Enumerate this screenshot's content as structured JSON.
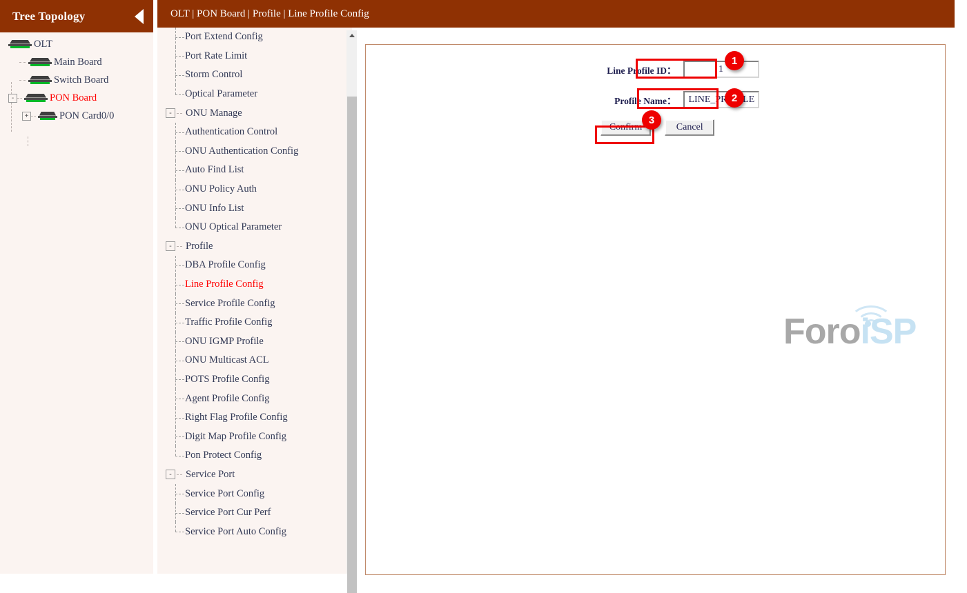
{
  "sidebar": {
    "title": "Tree Topology",
    "collapse_icon": "triangle-left-icon",
    "tree": [
      {
        "label": "OLT",
        "level": 0,
        "icon": "device-olt-icon",
        "expander": null,
        "highlight": false
      },
      {
        "label": "Main Board",
        "level": 1,
        "icon": "device-board-icon",
        "expander": null,
        "highlight": false
      },
      {
        "label": "Switch Board",
        "level": 1,
        "icon": "device-board-icon",
        "expander": null,
        "highlight": false
      },
      {
        "label": "PON Board",
        "level": 1,
        "icon": "device-board-icon",
        "expander": "-",
        "highlight": true
      },
      {
        "label": "PON Card0/0",
        "level": 2,
        "icon": "device-board-icon",
        "expander": "+",
        "highlight": false
      }
    ]
  },
  "topbar": {
    "breadcrumb": "OLT | PON Board | Profile | Line Profile Config"
  },
  "menu": {
    "items": [
      {
        "label": "Port Extend Config",
        "type": "leaf",
        "active": false
      },
      {
        "label": "Port Rate Limit",
        "type": "leaf",
        "active": false
      },
      {
        "label": "Storm Control",
        "type": "leaf",
        "active": false
      },
      {
        "label": "Optical Parameter",
        "type": "leaf",
        "active": false,
        "last": true
      },
      {
        "label": "ONU Manage",
        "type": "group",
        "active": false,
        "expander": "-"
      },
      {
        "label": "Authentication Control",
        "type": "leaf",
        "active": false
      },
      {
        "label": "ONU Authentication Config",
        "type": "leaf",
        "active": false
      },
      {
        "label": "Auto Find List",
        "type": "leaf",
        "active": false
      },
      {
        "label": "ONU Policy Auth",
        "type": "leaf",
        "active": false
      },
      {
        "label": "ONU Info List",
        "type": "leaf",
        "active": false
      },
      {
        "label": "ONU Optical Parameter",
        "type": "leaf",
        "active": false,
        "last": true
      },
      {
        "label": "Profile",
        "type": "group",
        "active": false,
        "expander": "-"
      },
      {
        "label": "DBA Profile Config",
        "type": "leaf",
        "active": false
      },
      {
        "label": "Line Profile Config",
        "type": "leaf",
        "active": true
      },
      {
        "label": "Service Profile Config",
        "type": "leaf",
        "active": false
      },
      {
        "label": "Traffic Profile Config",
        "type": "leaf",
        "active": false
      },
      {
        "label": "ONU IGMP Profile",
        "type": "leaf",
        "active": false
      },
      {
        "label": "ONU Multicast ACL",
        "type": "leaf",
        "active": false
      },
      {
        "label": "POTS Profile Config",
        "type": "leaf",
        "active": false
      },
      {
        "label": "Agent Profile Config",
        "type": "leaf",
        "active": false
      },
      {
        "label": "Right Flag Profile Config",
        "type": "leaf",
        "active": false
      },
      {
        "label": "Digit Map Profile Config",
        "type": "leaf",
        "active": false
      },
      {
        "label": "Pon Protect Config",
        "type": "leaf",
        "active": false,
        "last": true
      },
      {
        "label": "Service Port",
        "type": "group",
        "active": false,
        "expander": "-"
      },
      {
        "label": "Service Port Config",
        "type": "leaf",
        "active": false
      },
      {
        "label": "Service Port Cur Perf",
        "type": "leaf",
        "active": false
      },
      {
        "label": "Service Port Auto Config",
        "type": "leaf",
        "active": false,
        "last": true
      }
    ]
  },
  "form": {
    "line_profile_id_label": "Line Profile ID：",
    "line_profile_id_value": "1",
    "profile_name_label": "Profile Name：",
    "profile_name_value": "LINE_PROFILE",
    "confirm_label": "Confirm",
    "cancel_label": "Cancel"
  },
  "annotations": [
    {
      "number": "1",
      "target": "line-profile-id-input"
    },
    {
      "number": "2",
      "target": "profile-name-input"
    },
    {
      "number": "3",
      "target": "confirm-button"
    }
  ],
  "watermark": {
    "text_a": "Foro",
    "text_b": "iSP"
  },
  "colors": {
    "brand_brown": "#8f3103",
    "panel_bg": "#fbf4f1",
    "highlight_red": "#ff0000",
    "annotation_red": "#ee0000",
    "content_border": "#c08a6a",
    "led_green": "#00b828"
  }
}
